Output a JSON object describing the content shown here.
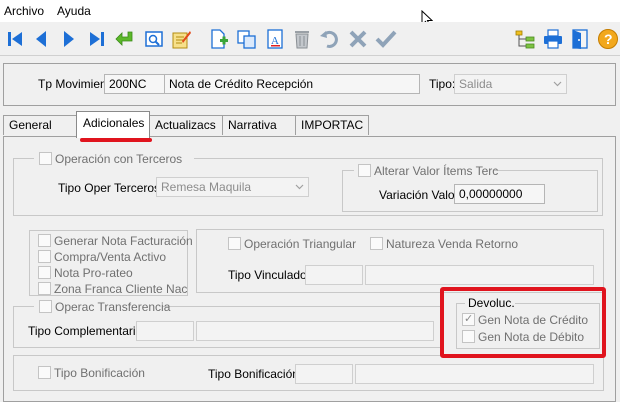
{
  "menu": {
    "archivo": "Archivo",
    "ayuda": "Ayuda"
  },
  "toolbar": {
    "icons": [
      "first-record",
      "previous-record",
      "next-record",
      "last-record",
      "return",
      "preview",
      "edit-document",
      "new-document",
      "copy",
      "text-format",
      "trash",
      "undo",
      "cancel",
      "confirm",
      "tree",
      "print",
      "exit-door",
      "help"
    ]
  },
  "header": {
    "tp_label": "Tp Movimien:",
    "tp_code": "200NC",
    "tp_desc": "Nota de Crédito Recepción",
    "tipo_label": "Tipo:",
    "tipo_value": "Salida"
  },
  "tabs": [
    "General",
    "Adicionales",
    "Actualizacs",
    "Narrativa",
    "IMPORTAC"
  ],
  "adicionales": {
    "operacion_terceros": "Operación con Terceros",
    "tipo_oper_label": "Tipo Oper Terceros:",
    "tipo_oper_value": "Remesa Maquila",
    "alterar_valor": "Alterar Valor Ítems Terc",
    "variacion_label": "Variación Valor:",
    "variacion_value": "0,00000000",
    "gen_nota_fact": "Generar Nota Facturación",
    "compra_venta": "Compra/Venta Activo",
    "nota_prorateo": "Nota Pro-rateo",
    "zona_franca": "Zona Franca Cliente Nac",
    "operacion_triangular": "Operación Triangular",
    "natureza_venda": "Natureza Venda Retorno",
    "tipo_vinculado_label": "Tipo Vinculado:",
    "operac_transferencia": "Operac Transferencia",
    "tipo_complementarios_label": "Tipo Complementarios:",
    "devoluc_title": "Devoluc.",
    "gen_nota_credito": "Gen Nota de Crédito",
    "gen_nota_debito": "Gen Nota de Débito",
    "tipo_bonificacion_cb": "Tipo Bonificación",
    "tipo_bonificacion_label": "Tipo Bonificación:"
  },
  "colors": {
    "highlight": "#e0141e",
    "toolbar_blue": "#1d6fd6"
  }
}
